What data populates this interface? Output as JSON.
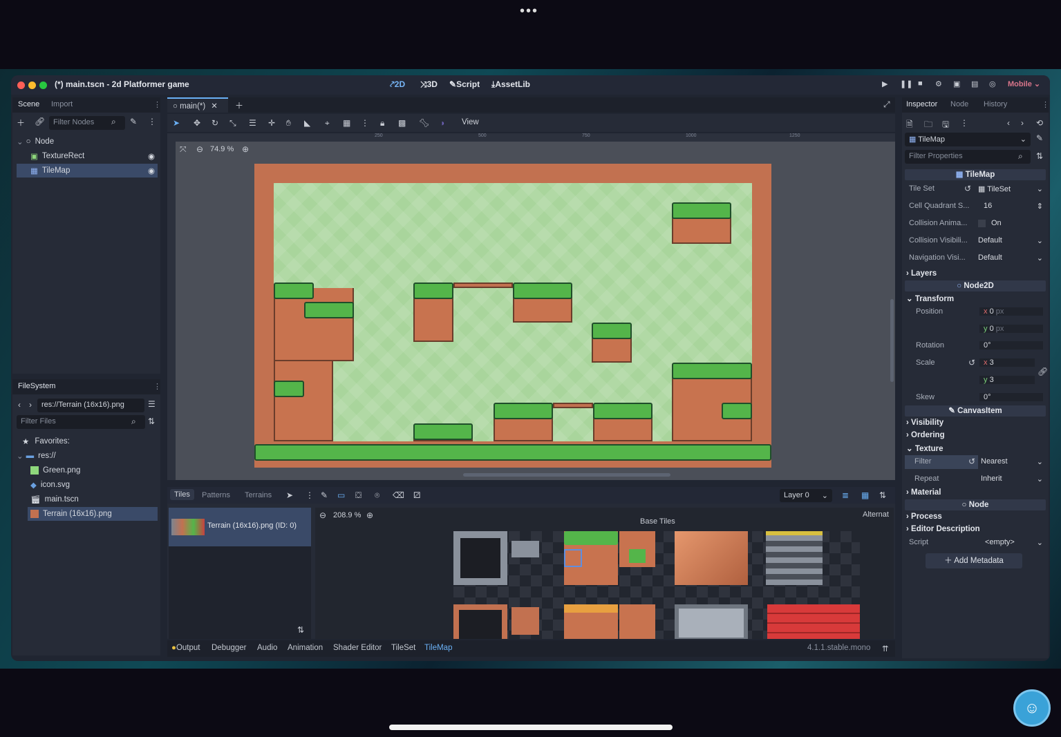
{
  "window": {
    "title": "(*) main.tscn - 2d Platformer game"
  },
  "main_menu": {
    "mode_2d": "2D",
    "mode_3d": "3D",
    "script": "Script",
    "assetlib": "AssetLib",
    "renderer": "Mobile"
  },
  "scene_dock": {
    "tabs": [
      "Scene",
      "Import"
    ],
    "filter_placeholder": "Filter Nodes",
    "tree": [
      {
        "label": "Node",
        "icon": "node-circle-icon"
      },
      {
        "label": "TextureRect",
        "icon": "texture-rect-icon"
      },
      {
        "label": "TileMap",
        "icon": "tilemap-grid-icon",
        "selected": true
      }
    ]
  },
  "filesystem_dock": {
    "tab": "FileSystem",
    "path": "res://Terrain (16x16).png",
    "filter_placeholder": "Filter Files",
    "items": [
      {
        "label": "Favorites:",
        "icon": "star-icon"
      },
      {
        "label": "res://",
        "icon": "folder-icon"
      },
      {
        "label": "Green.png",
        "icon": "image-icon"
      },
      {
        "label": "icon.svg",
        "icon": "svg-icon"
      },
      {
        "label": "main.tscn",
        "icon": "scene-icon"
      },
      {
        "label": "Terrain (16x16).png",
        "icon": "image-icon",
        "selected": true
      }
    ]
  },
  "editor_tabs": {
    "scene_tab": "main(*)"
  },
  "viewport_toolbar": {
    "view_menu": "View",
    "zoom": "74.9 %",
    "ruler_marks": [
      "250",
      "500",
      "750",
      "1000",
      "1250"
    ]
  },
  "tilemap_panel": {
    "tabs": [
      "Tiles",
      "Patterns",
      "Terrains"
    ],
    "layer": "Layer 0",
    "source_item": "Terrain (16x16).png (ID: 0)",
    "zoom": "208.9 %",
    "atlas_title": "Base Tiles",
    "alternative_label": "Alternat"
  },
  "bottom_bar": {
    "tabs": [
      "Output",
      "Debugger",
      "Audio",
      "Animation",
      "Shader Editor",
      "TileSet",
      "TileMap"
    ],
    "active": "TileMap",
    "version": "4.1.1.stable.mono"
  },
  "inspector": {
    "tabs": [
      "Inspector",
      "Node",
      "History"
    ],
    "object": "TileMap",
    "filter_placeholder": "Filter Properties",
    "class_header": "TileMap",
    "props": {
      "tile_set_label": "Tile Set",
      "tile_set_value": "TileSet",
      "cell_quadrant_label": "Cell Quadrant S...",
      "cell_quadrant_value": "16",
      "collision_anim_label": "Collision Anima...",
      "collision_anim_value": "On",
      "collision_vis_label": "Collision Visibili...",
      "collision_vis_value": "Default",
      "nav_vis_label": "Navigation Visi...",
      "nav_vis_value": "Default"
    },
    "layers_section": "Layers",
    "node2d_header": "Node2D",
    "transform_section": "Transform",
    "position_label": "Position",
    "position_x": "0",
    "position_y": "0",
    "px_unit": "px",
    "rotation_label": "Rotation",
    "rotation_value": "0",
    "scale_label": "Scale",
    "scale_x": "3",
    "scale_y": "3",
    "skew_label": "Skew",
    "skew_value": "0",
    "deg_unit": "°",
    "canvasitem_header": "CanvasItem",
    "visibility_section": "Visibility",
    "ordering_section": "Ordering",
    "texture_section": "Texture",
    "filter_label": "Filter",
    "filter_value": "Nearest",
    "repeat_label": "Repeat",
    "repeat_value": "Inherit",
    "material_section": "Material",
    "node_header": "Node",
    "process_section": "Process",
    "editor_desc_section": "Editor Description",
    "script_label": "Script",
    "script_value": "<empty>",
    "add_metadata": "Add Metadata"
  },
  "colors": {
    "accent": "#6ab0f5",
    "selection": "#3a4a68",
    "panel": "#262b37",
    "level_brick": "#c27150",
    "level_sky": "#a9d59c",
    "grass": "#54b54a"
  }
}
